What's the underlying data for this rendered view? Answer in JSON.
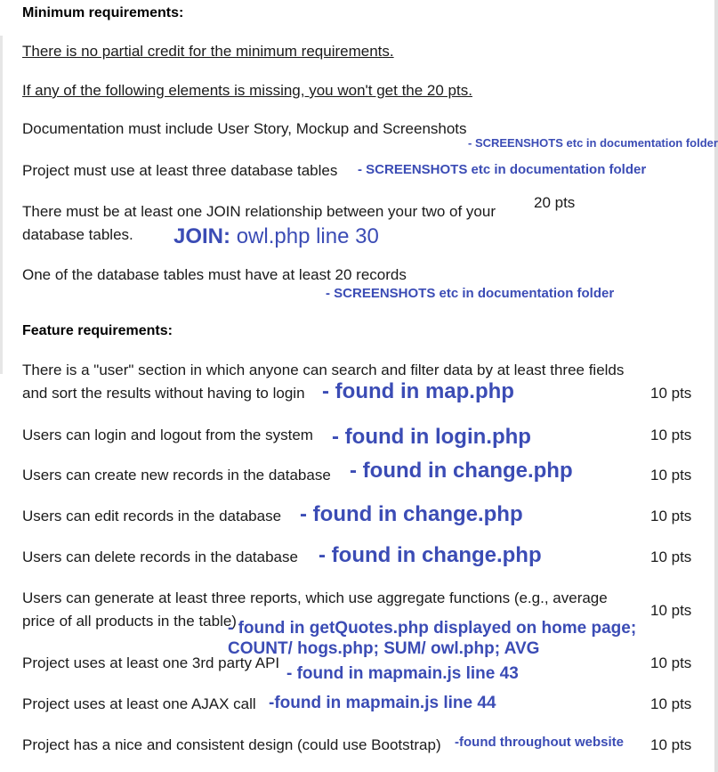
{
  "min_section": {
    "heading": "Minimum requirements:",
    "note_no_partial": "There is no partial credit for the minimum requirements.",
    "note_missing": "If any of the following elements is missing, you won't get the 20 pts.",
    "items": [
      {
        "text": "Documentation must include User Story, Mockup and Screenshots",
        "annotation": "- SCREENSHOTS etc in documentation folder"
      },
      {
        "text": "Project must use at least three database tables",
        "annotation": "- SCREENSHOTS etc in documentation folder"
      },
      {
        "text_line1": "There must be at least one JOIN relationship between your two of your",
        "text_line2": "database tables.",
        "annotation_prefix": "JOIN:",
        "annotation_rest": "owl.php line 30"
      },
      {
        "text": "One of the database tables must have at least 20 records",
        "annotation": "- SCREENSHOTS etc in documentation folder"
      }
    ],
    "points": "20 pts"
  },
  "feature_section": {
    "heading": "Feature requirements:",
    "items": [
      {
        "text_line1": "There is a \"user\" section in which anyone can search and filter data by at least three fields",
        "text_line2": "and sort the results without having to login",
        "annotation": "- found in map.php",
        "points": "10 pts"
      },
      {
        "text": "Users can login and logout from the system",
        "annotation": "- found in login.php",
        "points": "10 pts"
      },
      {
        "text": "Users can create new records in the database",
        "annotation": "- found in change.php",
        "points": "10 pts"
      },
      {
        "text": "Users can edit records in the database",
        "annotation": "- found in change.php",
        "points": "10 pts"
      },
      {
        "text": "Users can delete records in the database",
        "annotation": "- found in change.php",
        "points": "10 pts"
      },
      {
        "text_line1": "Users can generate at least three reports, which use aggregate functions (e.g., average",
        "text_line2": "price of all products in the table)",
        "annotation_line1": "- found in getQuotes.php displayed on home page;",
        "annotation_line2": "COUNT/ hogs.php; SUM/ owl.php; AVG",
        "points": "10 pts"
      },
      {
        "text": "Project uses at least one 3rd party API",
        "annotation": "- found in mapmain.js line 43",
        "points": "10 pts"
      },
      {
        "text": "Project uses at least one AJAX call",
        "annotation": "-found in mapmain.js line 44",
        "points": "10 pts"
      },
      {
        "text": "Project has a nice and consistent design (could use Bootstrap)",
        "annotation": "-found throughout website",
        "points": "10 pts"
      }
    ]
  },
  "colors": {
    "annotation": "#3b4cb5",
    "text": "#1a1a1a"
  }
}
